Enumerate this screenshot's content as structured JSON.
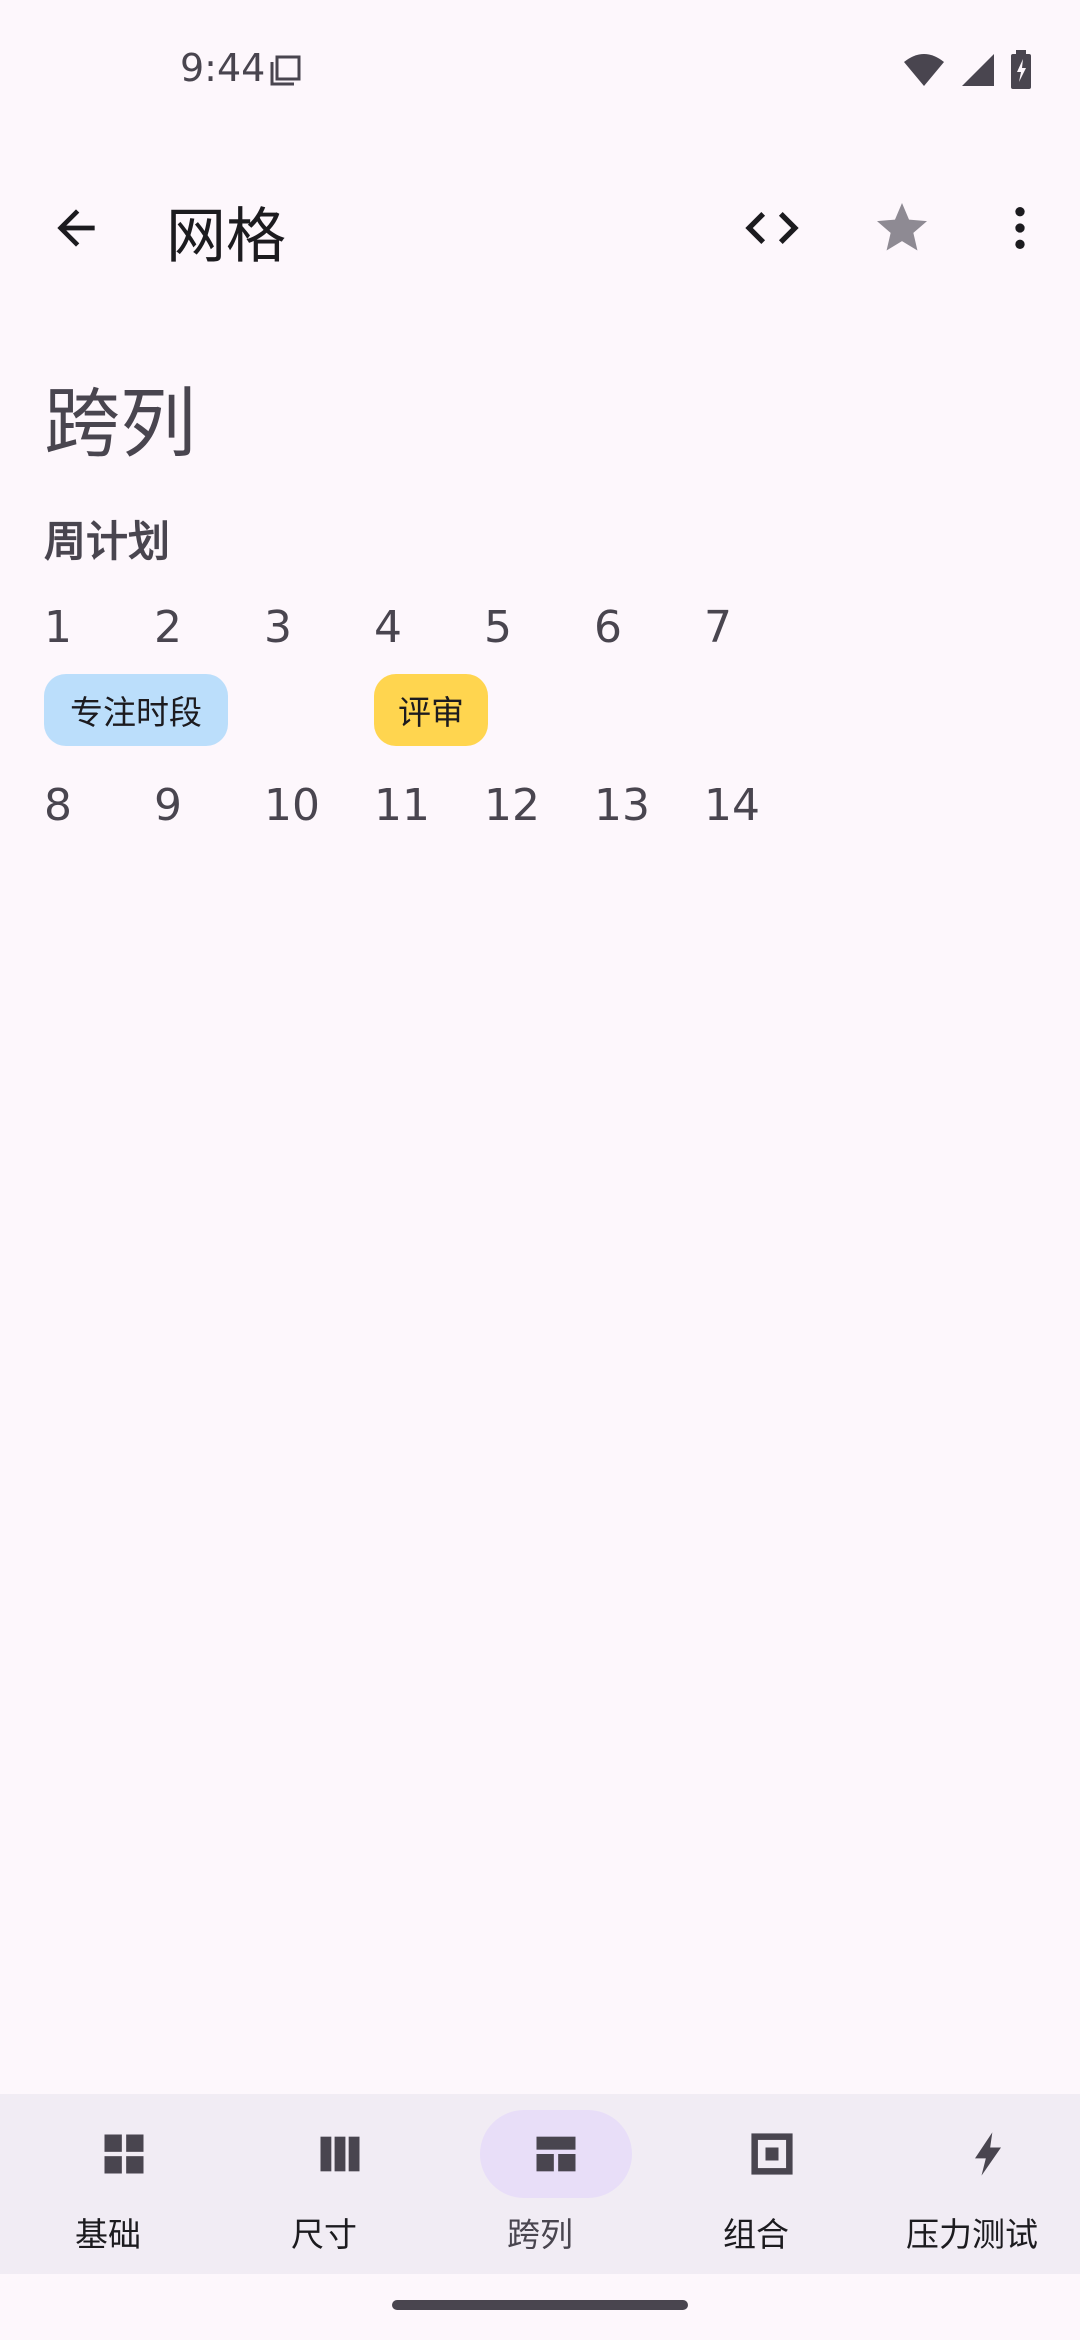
{
  "status_bar": {
    "time": "9:44"
  },
  "app_bar": {
    "title": "网格"
  },
  "content": {
    "section_title": "跨列",
    "subsection_title": "周计划",
    "week1": [
      "1",
      "2",
      "3",
      "4",
      "5",
      "6",
      "7"
    ],
    "events": [
      {
        "label": "专注时段",
        "color": "#BBDEFB"
      },
      {
        "label": "评审",
        "color": "#FFD54F"
      }
    ],
    "week2": [
      "8",
      "9",
      "10",
      "11",
      "12",
      "13",
      "14"
    ]
  },
  "bottom_nav": {
    "items": [
      {
        "label": "基础",
        "icon": "grid-icon"
      },
      {
        "label": "尺寸",
        "icon": "columns-icon"
      },
      {
        "label": "跨列",
        "icon": "span-layout-icon",
        "active": true
      },
      {
        "label": "组合",
        "icon": "nested-square-icon"
      },
      {
        "label": "压力测试",
        "icon": "bolt-icon"
      }
    ]
  },
  "colors": {
    "background": "#FDF7FC",
    "nav_background": "#F1ECF4",
    "active_pill": "#E8DEF8"
  }
}
